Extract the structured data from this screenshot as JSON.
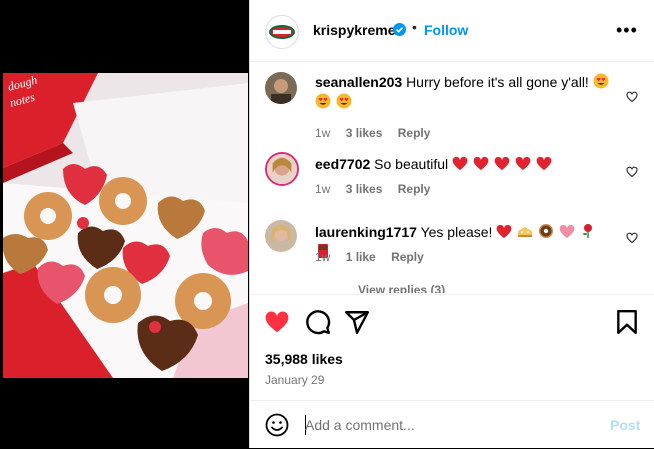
{
  "header": {
    "username": "krispykreme",
    "follow_label": "Follow",
    "dot": "•"
  },
  "media": {
    "box_lid_text_1": "dough",
    "box_lid_text_2": "notes"
  },
  "comments": [
    {
      "user": "seanallen203",
      "text": "Hurry before it's all gone y'all!",
      "age": "1w",
      "likes": "3 likes",
      "reply": "Reply",
      "emojis": [
        "heart-eyes-emoji",
        "heart-eyes-emoji",
        "heart-eyes-emoji"
      ]
    },
    {
      "user": "eed7702",
      "text": "So beautiful",
      "age": "1w",
      "likes": "3 likes",
      "reply": "Reply",
      "emojis": [
        "red-heart-emoji",
        "red-heart-emoji",
        "red-heart-emoji",
        "red-heart-emoji",
        "red-heart-emoji"
      ]
    },
    {
      "user": "laurenking1717",
      "text": "Yes please!",
      "age": "1w",
      "likes": "1 like",
      "reply": "Reply",
      "emojis": [
        "red-heart-emoji",
        "cake-emoji",
        "donut-emoji",
        "heart-emoji",
        "rose-emoji",
        "chocolate-emoji"
      ]
    }
  ],
  "view_replies": "View replies (3)",
  "post": {
    "likes": "35,988 likes",
    "date": "January 29"
  },
  "add_comment": {
    "placeholder": "Add a comment...",
    "post_label": "Post"
  },
  "colors": {
    "accent": "#0095f6",
    "like_red": "#ff3040",
    "muted": "#737373"
  }
}
